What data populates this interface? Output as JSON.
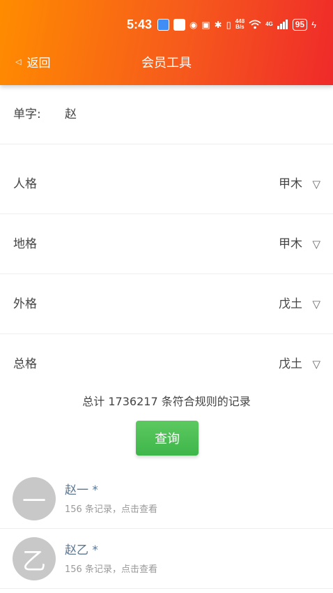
{
  "status_bar": {
    "time": "5:43",
    "net_speed_top": "448",
    "net_speed_bottom": "B/s",
    "signal_label": "4G",
    "battery": "95"
  },
  "nav": {
    "back_label": "返回",
    "title": "会员工具"
  },
  "form": {
    "single_char": {
      "label": "单字:",
      "value": "赵"
    },
    "rows": [
      {
        "label": "人格",
        "value": "甲木"
      },
      {
        "label": "地格",
        "value": "甲木"
      },
      {
        "label": "外格",
        "value": "戊土"
      },
      {
        "label": "总格",
        "value": "戊土"
      }
    ],
    "dropdown_glyph": "▽"
  },
  "summary": "总计 1736217 条符合规则的记录",
  "query_button": "查询",
  "results": [
    {
      "avatar": "一",
      "name": "赵一 *",
      "sub": "156 条记录，点击查看"
    },
    {
      "avatar": "乙",
      "name": "赵乙 *",
      "sub": "156 条记录，点击查看"
    }
  ],
  "colors": {
    "header_start": "#ff8c00",
    "header_end": "#ef2a2a",
    "button": "#4bbf52",
    "avatar": "#c8c8c8",
    "result_name": "#5b7691"
  }
}
